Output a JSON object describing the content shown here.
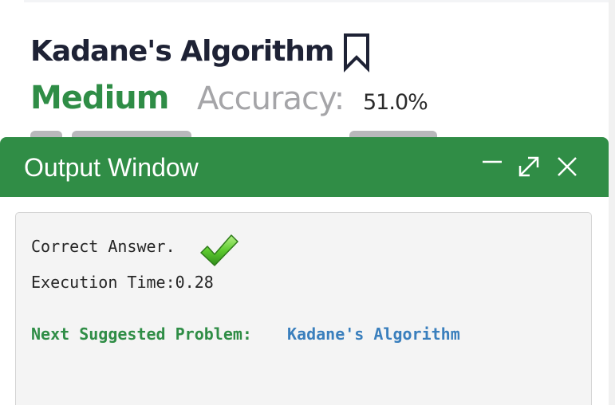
{
  "problem": {
    "title": "Kadane's Algorithm",
    "difficulty": "Medium",
    "accuracy_label": "Accuracy:",
    "accuracy_value": "51.0%"
  },
  "output_window": {
    "title": "Output Window",
    "result_text": "Correct Answer.",
    "execution_time": "Execution Time:0.28",
    "next_label": "Next Suggested Problem:",
    "next_link": "Kadane's Algorithm"
  },
  "icons": {
    "bookmark": "bookmark-icon",
    "minimize": "minimize-icon",
    "expand": "expand-icon",
    "close": "close-icon",
    "check": "check-icon"
  },
  "colors": {
    "brand_green": "#308d46",
    "difficulty_green": "#2f8d46",
    "link_blue": "#3a7fbd",
    "title_dark": "#1e2235",
    "muted_gray": "#a5a5a8"
  }
}
